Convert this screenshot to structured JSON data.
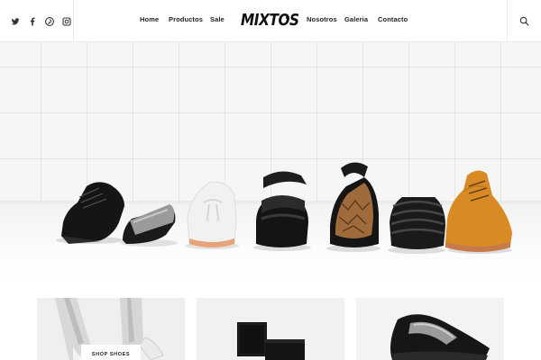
{
  "header": {
    "brand": "MIXTOS",
    "social": [
      "twitter-icon",
      "facebook-icon",
      "pinterest-icon",
      "instagram-icon"
    ],
    "nav_left": [
      "Home",
      "Productos",
      "Sale"
    ],
    "nav_right": [
      "Nosotros",
      "Galeria",
      "Contacto"
    ],
    "search_icon": "search-icon"
  },
  "hero": {
    "shoe_colors": [
      "#141414",
      "#9a9a9a",
      "#f2f2f2",
      "#121212",
      "#a06b3c",
      "#1c1c1c",
      "#d88a25"
    ]
  },
  "products": {
    "cards": [
      {
        "button_label": "SHOP SHOES"
      },
      {
        "button_label": ""
      },
      {
        "button_label": ""
      }
    ]
  }
}
